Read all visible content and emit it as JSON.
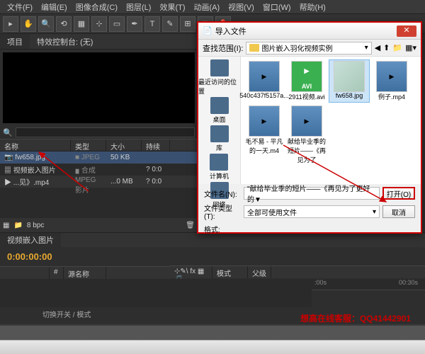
{
  "menubar": [
    "文件(F)",
    "编辑(E)",
    "图像合成(C)",
    "图层(L)",
    "效果(T)",
    "动画(A)",
    "视图(V)",
    "窗口(W)",
    "帮助(H)"
  ],
  "panel_tabs": {
    "project": "项目",
    "fx": "特效控制台: (无)"
  },
  "proj_headers": {
    "name": "名称",
    "type": "类型",
    "size": "大小",
    "dur": "持续时"
  },
  "proj_rows": [
    {
      "name": "fw658.jpg",
      "type": "JPEG",
      "size": "50 KB",
      "dur": ""
    },
    {
      "name": "视频嵌入图片",
      "type": "合成",
      "size": "",
      "dur": "? 0:0"
    },
    {
      "name": "...见》.mp4",
      "type": "MPEG 影片",
      "size": "...0 MB",
      "dur": "? 0:0"
    }
  ],
  "proj_footer": {
    "bpc": "8 bpc"
  },
  "timeline": {
    "tab": "视频嵌入图片",
    "timecode": "0:00:00:00",
    "headers": {
      "num": "#",
      "src": "源名称",
      "mode": "模式",
      "parent": "父级"
    },
    "ruler": {
      "t0": ":00s",
      "t1": "00:30s"
    },
    "toggle": "切换开关 / 模式"
  },
  "dialog": {
    "title": "导入文件",
    "path_label": "查找范围(I):",
    "path_value": "图片嵌入羽化视频实例",
    "side": [
      "最近访问的位置",
      "桌面",
      "库",
      "计算机",
      "网络"
    ],
    "files": [
      {
        "name": "540c437f5157a...",
        "kind": "media"
      },
      {
        "name": "2911视频.avi",
        "kind": "avi",
        "badge": "AVI"
      },
      {
        "name": "fw658.jpg",
        "kind": "img",
        "sel": true
      },
      {
        "name": "例子.mp4",
        "kind": "media"
      },
      {
        "name": "毛不易 - 平凡的一天.m4",
        "kind": "media"
      },
      {
        "name": "献给毕业季的短片——《再见为了",
        "kind": "media"
      }
    ],
    "filename_label": "文件名(N):",
    "filename_value": "\"献给毕业季的短片——《再见为了更好的▼",
    "filetype_label": "文件类型(T):",
    "filetype_value": "全部可使用文件",
    "fmt_label": "格式:",
    "open_btn": "打开(O)",
    "cancel_btn": "取消"
  },
  "watermark": "想高在线客服：QQ41442901"
}
